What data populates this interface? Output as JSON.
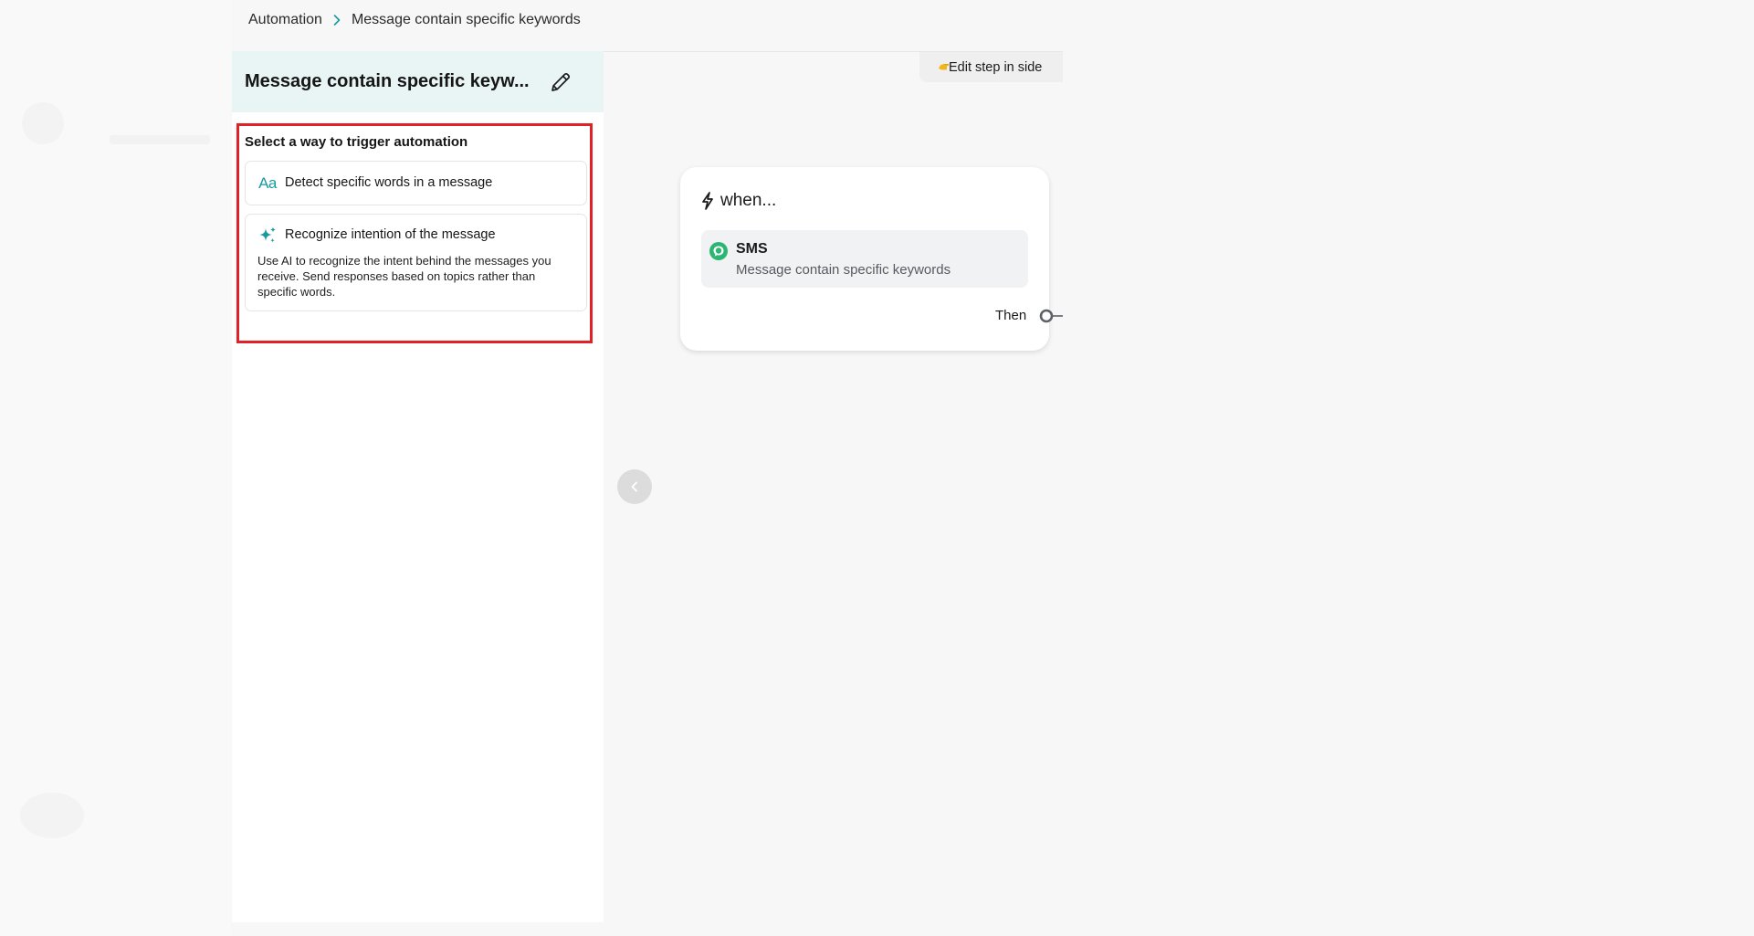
{
  "breadcrumb": {
    "root": "Automation",
    "current": "Message contain specific keywords",
    "separator_icon": "chevron-right-icon"
  },
  "panel": {
    "title": "Message contain specific keyw...",
    "edit_icon": "pencil-icon",
    "section_label": "Select a way to trigger automation",
    "options": [
      {
        "icon": "text-aa-icon",
        "icon_text": "Aa",
        "title": "Detect specific words in a message",
        "description": ""
      },
      {
        "icon": "sparkles-ai-icon",
        "title": "Recognize intention of the message",
        "description": "Use AI to recognize the intent behind the messages you receive. Send responses based on topics rather than specific words."
      }
    ]
  },
  "canvas": {
    "edit_step_label": "Edit step in side",
    "edit_step_icon": "pointing-hand-icon",
    "node": {
      "icon": "lightning-bolt-icon",
      "header": "when...",
      "trigger": {
        "icon": "sms-bubble-icon",
        "title": "SMS",
        "subtitle": "Message contain specific keywords"
      },
      "then_label": "Then"
    },
    "collapse_icon": "chevron-left-icon"
  },
  "colors": {
    "accent_teal": "#1a9aa0",
    "header_bg": "#e9f5f5",
    "highlight_red": "#e02127",
    "sms_green": "#2bb673"
  }
}
